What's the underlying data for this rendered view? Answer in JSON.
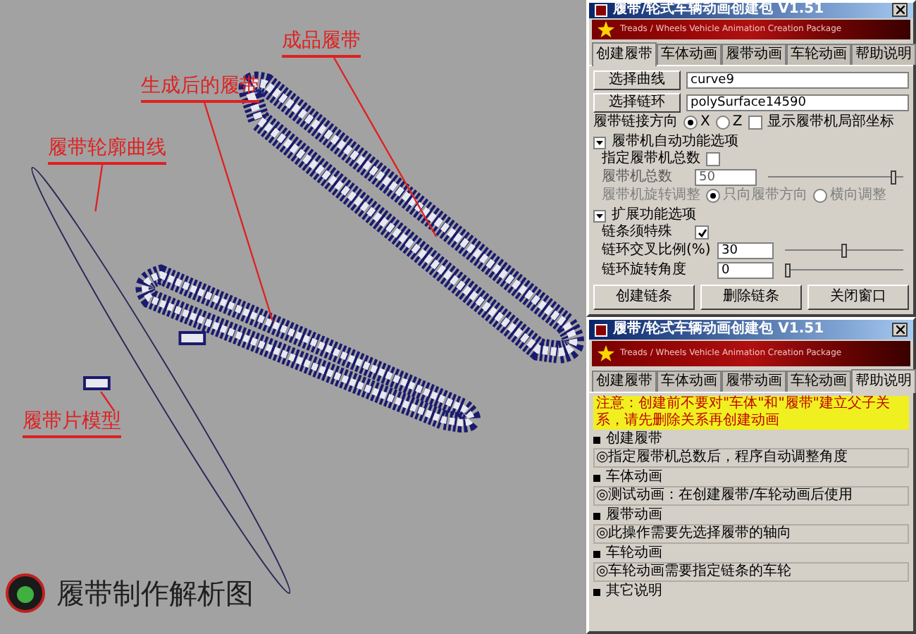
{
  "viewport": {
    "labels": [
      {
        "text": "成品履带"
      },
      {
        "text": "生成后的履带"
      },
      {
        "text": "履带轮廓曲线"
      },
      {
        "text": "履带片模型"
      }
    ],
    "caption": "履带制作解析图"
  },
  "tool_window": {
    "title": "履带/轮式车辆动画创建包 V1.51",
    "subtitle": "Treads / Wheels Vehicle Animation Creation Package",
    "tabs": [
      {
        "label": "创建履带",
        "selected": true
      },
      {
        "label": "车体动画",
        "selected": false
      },
      {
        "label": "履带动画",
        "selected": false
      },
      {
        "label": "车轮动画",
        "selected": false
      },
      {
        "label": "帮助说明",
        "selected": false
      }
    ],
    "curve": {
      "button": "选择曲线",
      "value": "curve9"
    },
    "link": {
      "button": "选择链环",
      "value": "polySurface14590"
    },
    "direction": {
      "label": "履带链接方向",
      "options": [
        {
          "label": "X",
          "selected": true
        },
        {
          "label": "Z",
          "selected": false
        }
      ]
    },
    "show_axis": {
      "label": "显示履带机局部坐标",
      "checked": false
    },
    "auto_section": {
      "title": "履带机自动功能选项",
      "expanded": true,
      "specify": {
        "label": "指定履带机总数",
        "checked": false
      },
      "count": {
        "label": "履带机总数",
        "value": "50",
        "disabled": true,
        "level": 0.95
      },
      "rotate": {
        "label": "履带机旋转调整",
        "disabled": true,
        "options": [
          {
            "label": "只向履带方向",
            "selected": true
          },
          {
            "label": "横向调整",
            "selected": false
          }
        ]
      }
    },
    "ext_section": {
      "title": "扩展功能选项",
      "expanded": true,
      "loop": {
        "label": "链条须特殊",
        "checked": true
      },
      "overlap": {
        "label": "链环交叉比例(%)",
        "value": "30",
        "level": 0.5
      },
      "angle": {
        "label": "链环旋转角度",
        "value": "0",
        "level": 0.0
      }
    },
    "buttons": [
      "创建链条",
      "删除链条",
      "关闭窗口"
    ]
  },
  "help_window": {
    "title": "履带/轮式车辆动画创建包 V1.51",
    "subtitle": "Treads / Wheels Vehicle Animation Creation Package",
    "tabs": [
      {
        "label": "创建履带",
        "selected": false
      },
      {
        "label": "车体动画",
        "selected": false
      },
      {
        "label": "履带动画",
        "selected": false
      },
      {
        "label": "车轮动画",
        "selected": false
      },
      {
        "label": "帮助说明",
        "selected": true
      }
    ],
    "notice": "注意：创建前不要对\"车体\"和\"履带\"建立父子关系，请先删除关系再创建动画",
    "sections": [
      {
        "title": "创建履带",
        "lines": [
          "◎指定履带机总数后，程序自动调整角度"
        ]
      },
      {
        "title": "车体动画",
        "lines": [
          "◎测试动画：在创建履带/车轮动画后使用"
        ]
      },
      {
        "title": "履带动画",
        "lines": [
          "◎此操作需要先选择履带的轴向"
        ]
      },
      {
        "title": "车轮动画",
        "lines": [
          "◎车轮动画需要指定链条的车轮"
        ]
      },
      {
        "title": "其它说明"
      }
    ]
  }
}
